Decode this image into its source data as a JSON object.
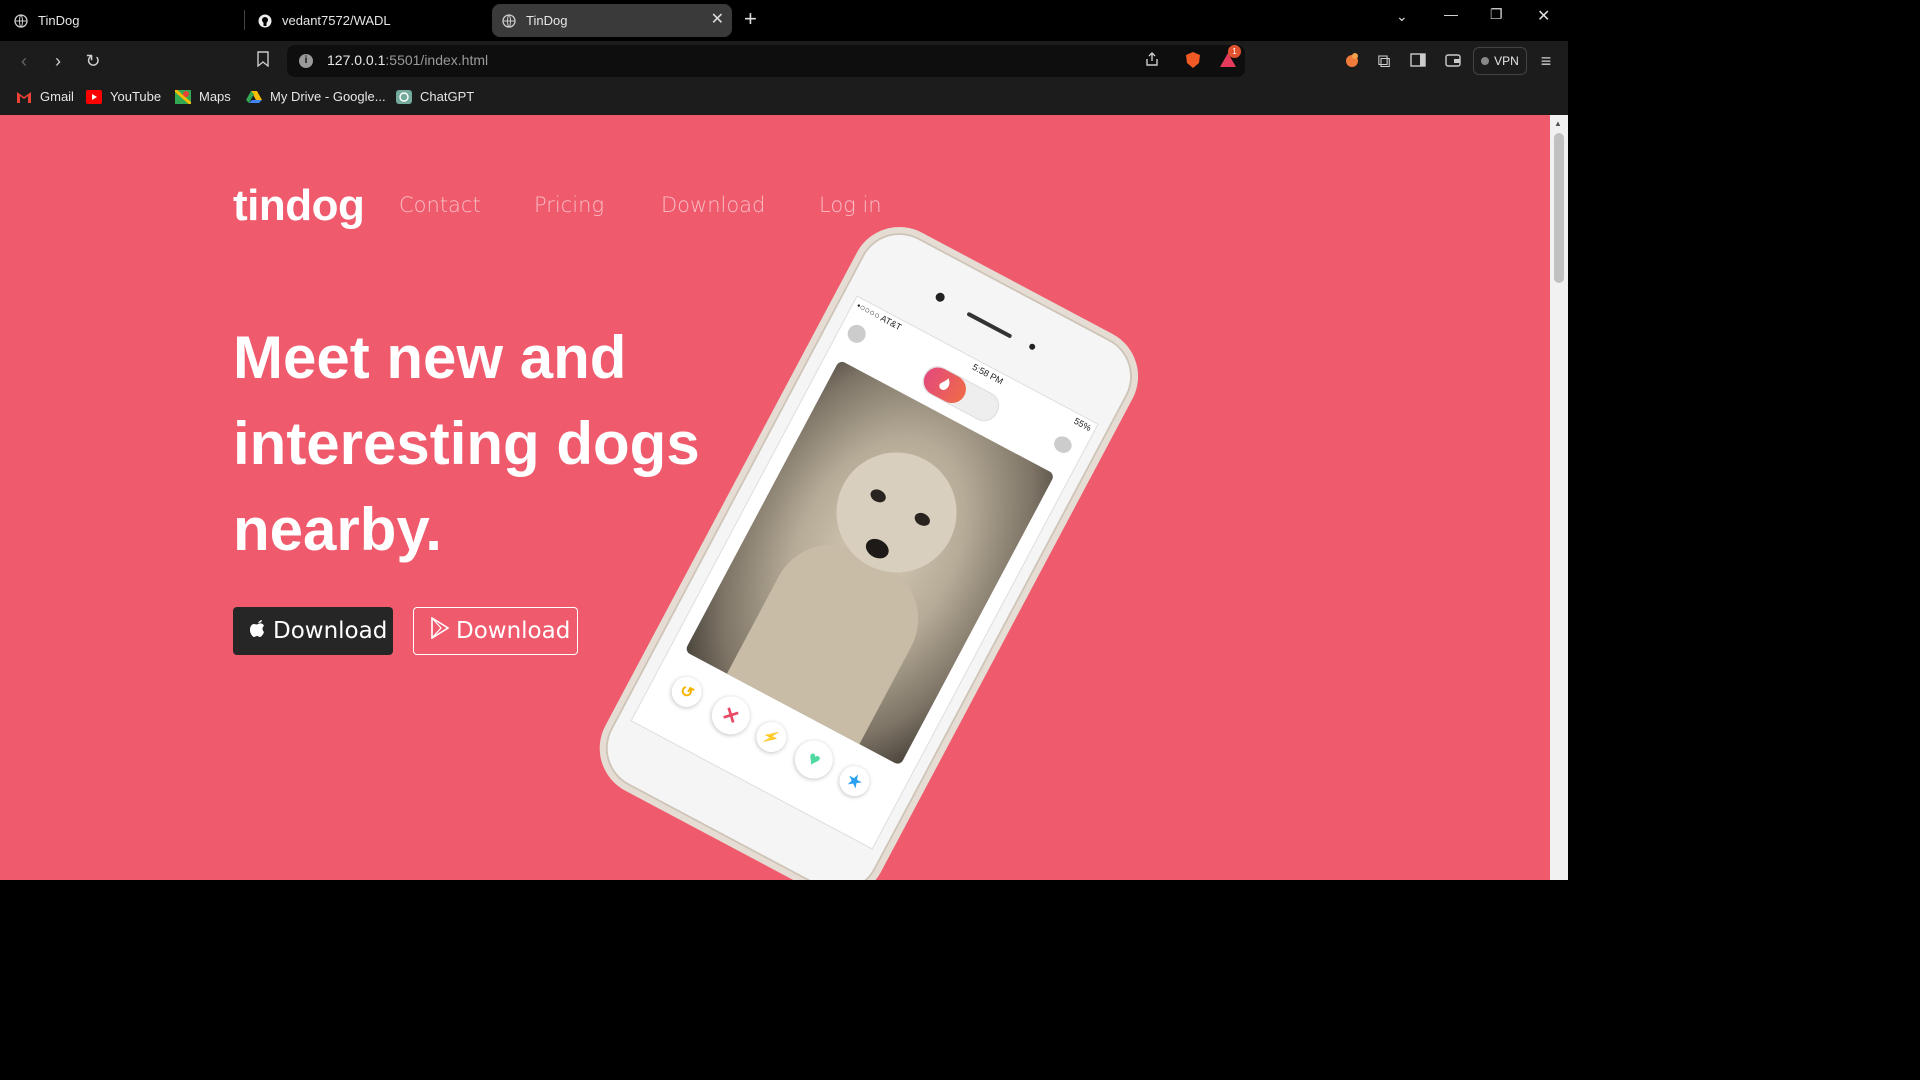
{
  "browser": {
    "tabs": [
      {
        "title": "TinDog"
      },
      {
        "title": "vedant7572/WADL"
      },
      {
        "title": "TinDog",
        "active": true
      }
    ],
    "new_tab": "+",
    "url_host": "127.0.0.1",
    "url_rest": ":5501/index.html",
    "vpn_label": "VPN",
    "notification_count": "1",
    "bookmarks": [
      {
        "label": "Gmail"
      },
      {
        "label": "YouTube"
      },
      {
        "label": "Maps"
      },
      {
        "label": "My Drive - Google..."
      },
      {
        "label": "ChatGPT"
      }
    ]
  },
  "page": {
    "brand": "tindog",
    "nav": [
      "Contact",
      "Pricing",
      "Download",
      "Log in"
    ],
    "headline_lines": [
      "Meet new and",
      "interesting dogs",
      "nearby."
    ],
    "btn_apple": "Download",
    "btn_play": "Download",
    "phone": {
      "carrier": "•○○○○ AT&T",
      "time": "5:58 PM",
      "battery": "55%"
    }
  },
  "colors": {
    "page_bg": "#ef5a6d",
    "apple_btn_bg": "#262626"
  }
}
